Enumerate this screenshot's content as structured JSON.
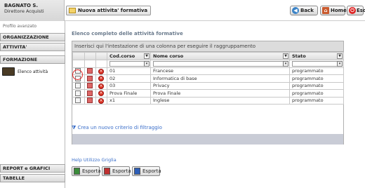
{
  "user": {
    "name": "BAGNATO S.",
    "role": "Direttore Acquisti"
  },
  "header": {
    "tab_title": "Nuova attivita' formativa",
    "back_label": "Back",
    "home_label": "Home",
    "exit_label": "Esci"
  },
  "sidebar": {
    "profile_label": "Profilo avanzato",
    "sections": {
      "organizzazione": "ORGANIZZAZIONE",
      "attivita": "ATTIVITA'",
      "formazione": "FORMAZIONE",
      "report": "REPORT e GRAFICI",
      "tabelle": "TABELLE"
    },
    "elenco_item": "Elenco attività"
  },
  "main": {
    "title": "Elenco completo delle attività formative",
    "group_hint": "Inserisci qui l'intestazione di una colonna per eseguire il raggruppamento",
    "columns": {
      "code": "Cod.corso",
      "name": "Nome corso",
      "status": "Stato"
    },
    "rows": [
      {
        "code": "01",
        "name": "Francese",
        "status": "programmato"
      },
      {
        "code": "02",
        "name": "Informatica di base",
        "status": "programmato"
      },
      {
        "code": "03",
        "name": "Privacy",
        "status": "programmato"
      },
      {
        "code": "Prova Finale",
        "name": "Prova Finale",
        "status": "programmato"
      },
      {
        "code": "x1",
        "name": "Inglese",
        "status": "programmato"
      }
    ],
    "add_filter": "Crea un nuovo criterio di filtraggio",
    "help_link": "Help Utilizzo Griglia",
    "export_label": "Esporta"
  }
}
